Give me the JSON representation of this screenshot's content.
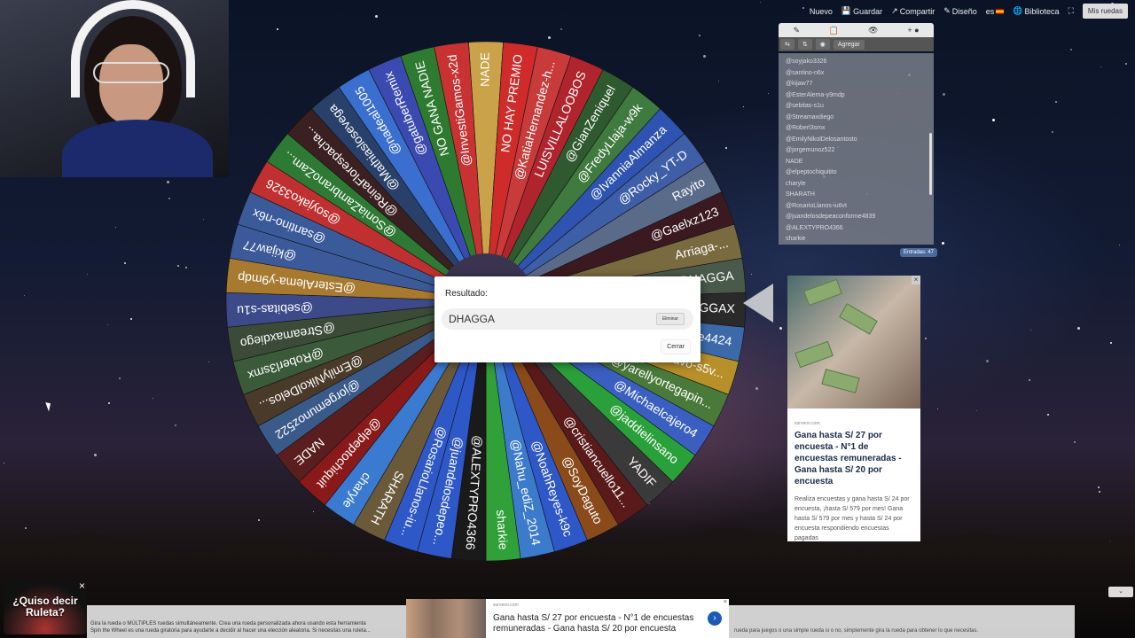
{
  "topnav": {
    "new_label": "Nuevo",
    "save_label": "Guardar",
    "share_label": "Compartir",
    "design_label": "Diseño",
    "language_label": "es",
    "library_label": "Biblioteca",
    "my_wheels_label": "Mis ruedas"
  },
  "wheel": {
    "segments": [
      "NADE",
      "NO HAY PREMIO",
      "@KatiaHernandez-h...",
      "LUISVILLALOOBOS",
      "@GianZeniquel",
      "@FredyLlaja-w9k",
      "@IvanniaAlmanza",
      "@Rocky_YT-D",
      "Rayito",
      "@Gaelxz123",
      "Arriaga-...",
      "DHAGGA",
      "AGGAX",
      "...ze4424",
      "...essicaBravo-s5v...",
      "@yarellyortegapin...",
      "@Michaelcajero4",
      "@jaddielinsano",
      "YADIF",
      "@cristiancuello11...",
      "@SoyDaguto",
      "@NoahReyes-k9c",
      "@Nahu_ediZ_2014",
      "sharkie",
      "@ALEXTYPRO4366",
      "@juandelosdepeo...",
      "@RosarioLlanos-iu...",
      "SHARATH",
      "charyle",
      "@elpeptochiquit",
      "NADE",
      "@jorgemunoz522",
      "@EmilyNikolDelos...",
      "@Roberl3smx",
      "@Streamaxdiego",
      "@sebitas-s1u",
      "@EsterAlema-y9mdp",
      "@kijaw77",
      "@santino-n6x",
      "@soyjako3326",
      "@SoniaZambranoZam...",
      "@ReinaFlorespacha...",
      "@Mathiaslosevega",
      "@nadeal1005",
      "@gatuberRemix",
      "NO GANA NADIE",
      "@InvestiGamos-x2d"
    ],
    "colors": [
      "#c9a24a",
      "#d02b2b",
      "#c93b3b",
      "#b0242d",
      "#2f5a2f",
      "#3f7a3f",
      "#2e53b0",
      "#3f5ea8",
      "#5a6b8a",
      "#3a1a20",
      "#7a6a40",
      "#4a5a4a",
      "#2a2a2a",
      "#3c6aa8",
      "#b8902a",
      "#4a7a3a",
      "#3a5fc0",
      "#2aa03a",
      "#3a3a3a",
      "#5a1a1a",
      "#8a4a1a",
      "#2e57c8",
      "#3c7acc",
      "#30a038",
      "#1a1a1a",
      "#2e57c8",
      "#2e57c8",
      "#6a5a3a",
      "#3a7ad0",
      "#8a1a1a",
      "#5a1e1e",
      "#3a5a8a",
      "#4a3a2a",
      "#3a5a3a",
      "#3c4a38",
      "#3c4a8a",
      "#a87a30",
      "#3c5a9a",
      "#3a5a9a",
      "#c03030",
      "#2e7a34",
      "#3a2020",
      "#28406a",
      "#3a6fd0",
      "#3a4ab0",
      "#2e7a30",
      "#c83232"
    ]
  },
  "dialog": {
    "title": "Resultado:",
    "result": "DHAGGA",
    "remove_label": "Eliminar",
    "close_label": "Cerrar"
  },
  "panel": {
    "add_label": "Agregar",
    "entries": [
      "@soyjako3326",
      "@santino-n6x",
      "@kijaw77",
      "@EsterAlema-y9mdp",
      "@sebitas-s1u",
      "@Streamaxdiego",
      "@Roberl3smx",
      "@EmilyNikolDelosantosto",
      "@jorgemunoz522",
      "NADE",
      "@elpeptochiquitito",
      "charyle",
      "SHARATH",
      "@RosarioLlanos-iu6vt",
      "@juandelosdepeaconforme4839",
      "@ALEXTYPRO4366",
      "sharkie"
    ],
    "count_label": "Entradas: 47"
  },
  "side_ad": {
    "source": "surveoo.com",
    "headline": "Gana hasta S/ 27 por encuesta - N°1 de encuestas remuneradas - Gana hasta S/ 20 por encuesta",
    "body": "Realiza encuestas y gana hasta S/ 24 por encuesta, ¡hasta S/ 579 por mes! Gana hasta S/ 579 por mes y hasta S/ 24 por encuesta respondiendo encuestas pagadas"
  },
  "bottom": {
    "text1": "Gira la rueda o MÚLTIPLES ruedas simultáneamente. Crea una rueda personalizada ahora usando esta herramienta",
    "text2": "Spin the Wheel es una rueda giratoria para ayudarte a decidir al hacer una elección aleatoria. Si necesitas una ruleta...",
    "text3": "rueda para juegos o una simple rueda si o no, simplemente gira la rueda para obtener lo que necesitas.",
    "quiso_label": "¿Quiso decir Ruleta?",
    "ad_source": "surveoo.com",
    "ad_text": "Gana hasta S/ 27 por encuesta - N°1 de encuestas remuneradas - Gana hasta S/ 20 por encuesta"
  }
}
